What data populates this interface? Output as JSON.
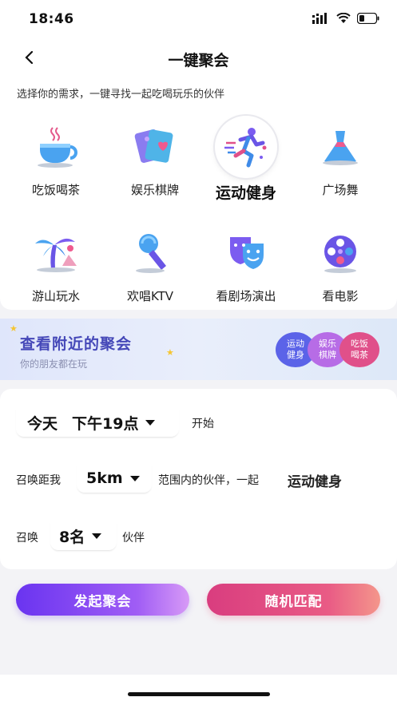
{
  "status_bar": {
    "time": "18:46"
  },
  "nav": {
    "title": "一键聚会"
  },
  "subtitle": "选择你的需求，一键寻找一起吃喝玩乐的伙伴",
  "categories": [
    {
      "label": "吃饭喝茶",
      "icon": "tea-cup-icon"
    },
    {
      "label": "娱乐棋牌",
      "icon": "cards-icon"
    },
    {
      "label": "运动健身",
      "icon": "running-icon",
      "selected": true
    },
    {
      "label": "广场舞",
      "icon": "dancing-dress-icon"
    },
    {
      "label": "游山玩水",
      "icon": "palm-tree-icon"
    },
    {
      "label": "欢唱KTV",
      "icon": "microphone-icon"
    },
    {
      "label": "看剧场演出",
      "icon": "theater-mask-icon"
    },
    {
      "label": "看电影",
      "icon": "film-reel-icon"
    }
  ],
  "banner": {
    "title": "查看附近的聚会",
    "subtitle": "你的朋友都在玩",
    "bubbles": [
      {
        "line1": "运动",
        "line2": "健身",
        "color": "#5b63e8"
      },
      {
        "line1": "娱乐",
        "line2": "棋牌",
        "color": "#b76ce6"
      },
      {
        "line1": "吃饭",
        "line2": "喝茶",
        "color": "#e0508a"
      }
    ]
  },
  "form": {
    "day": "今天",
    "time": "下午19点",
    "start_label": "开始",
    "summon_prefix": "召唤距我",
    "distance": "5km",
    "range_text": "范围内的伙伴，一起",
    "activity": "运动健身",
    "count_prefix": "召唤",
    "count": "8名",
    "count_suffix": "伙伴"
  },
  "buttons": {
    "launch": "发起聚会",
    "random": "随机匹配"
  },
  "colors": {
    "accent_purple": "#6a34f0",
    "accent_pink": "#e0508a",
    "banner_title": "#4548b8"
  }
}
